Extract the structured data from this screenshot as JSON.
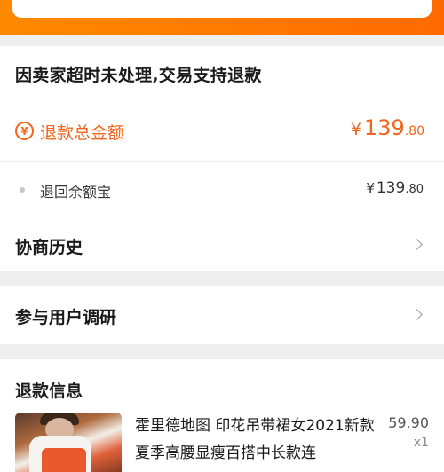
{
  "refund_status": {
    "message": "因卖家超时未处理,交易支持退款"
  },
  "refund_total": {
    "icon": "yen-circle-icon",
    "label": "退款总金额",
    "currency": "¥",
    "amount_int": "139",
    "amount_dec": ".80",
    "color": "#f0661e"
  },
  "refund_destination": {
    "label": "退回余额宝",
    "currency": "¥",
    "amount_int": "139",
    "amount_dec": ".80"
  },
  "negotiation_history": {
    "label": "协商历史"
  },
  "user_survey": {
    "label": "参与用户调研"
  },
  "refund_info": {
    "title": "退款信息",
    "product": {
      "name": "霍里德地图 印花吊带裙女2021新款夏季高腰显瘦百搭中长款连",
      "price": "59.90",
      "quantity": "x1"
    }
  },
  "theme": {
    "banner_color": "#ff7a00",
    "accent": "#f0661e"
  }
}
